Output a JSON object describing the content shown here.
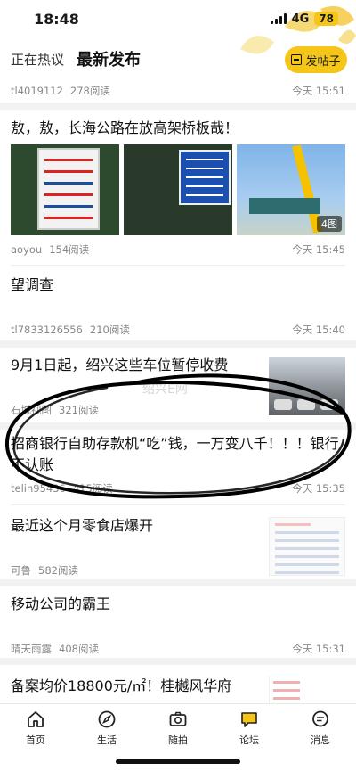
{
  "status_bar": {
    "time": "18:48",
    "network": "4G",
    "battery": "78"
  },
  "header": {
    "tab_hot": "正在热议",
    "tab_new": "最新发布",
    "post_button": "发帖子",
    "accent": "#F5C518"
  },
  "posts": [
    {
      "author": "tl4019112",
      "reads": "278阅读",
      "time": "今天 15:51"
    },
    {
      "title": "敖，敖，长海公路在放高架桥板哉！",
      "author": "aoyou",
      "reads": "154阅读",
      "time": "今天 15:45",
      "image_count": "4图"
    },
    {
      "title": "望调查",
      "author": "tl7833126556",
      "reads": "210阅读",
      "time": "今天 15:40"
    },
    {
      "title": "9月1日起，绍兴这些车位暂停收费",
      "author": "石城视图",
      "reads": "321阅读"
    },
    {
      "title": "招商银行自助存款机“吃”钱，一万变八千！！！银行不认账",
      "author": "telin95436",
      "reads": "415阅读",
      "time": "今天 15:35"
    },
    {
      "title": "最近这个月零食店爆开",
      "author": "可鲁",
      "reads": "582阅读"
    },
    {
      "title": "移动公司的霸王",
      "author": "晴天雨露",
      "reads": "408阅读",
      "time": "今天 15:31"
    },
    {
      "title": "备案均价18800元/㎡！桂樾风华府"
    }
  ],
  "watermark": "绍兴E网",
  "tabbar": {
    "items": [
      {
        "label": "首页",
        "icon": "home-icon"
      },
      {
        "label": "生活",
        "icon": "compass-icon"
      },
      {
        "label": "随拍",
        "icon": "camera-icon"
      },
      {
        "label": "论坛",
        "icon": "chat-bubble-icon"
      },
      {
        "label": "消息",
        "icon": "message-icon"
      }
    ]
  }
}
